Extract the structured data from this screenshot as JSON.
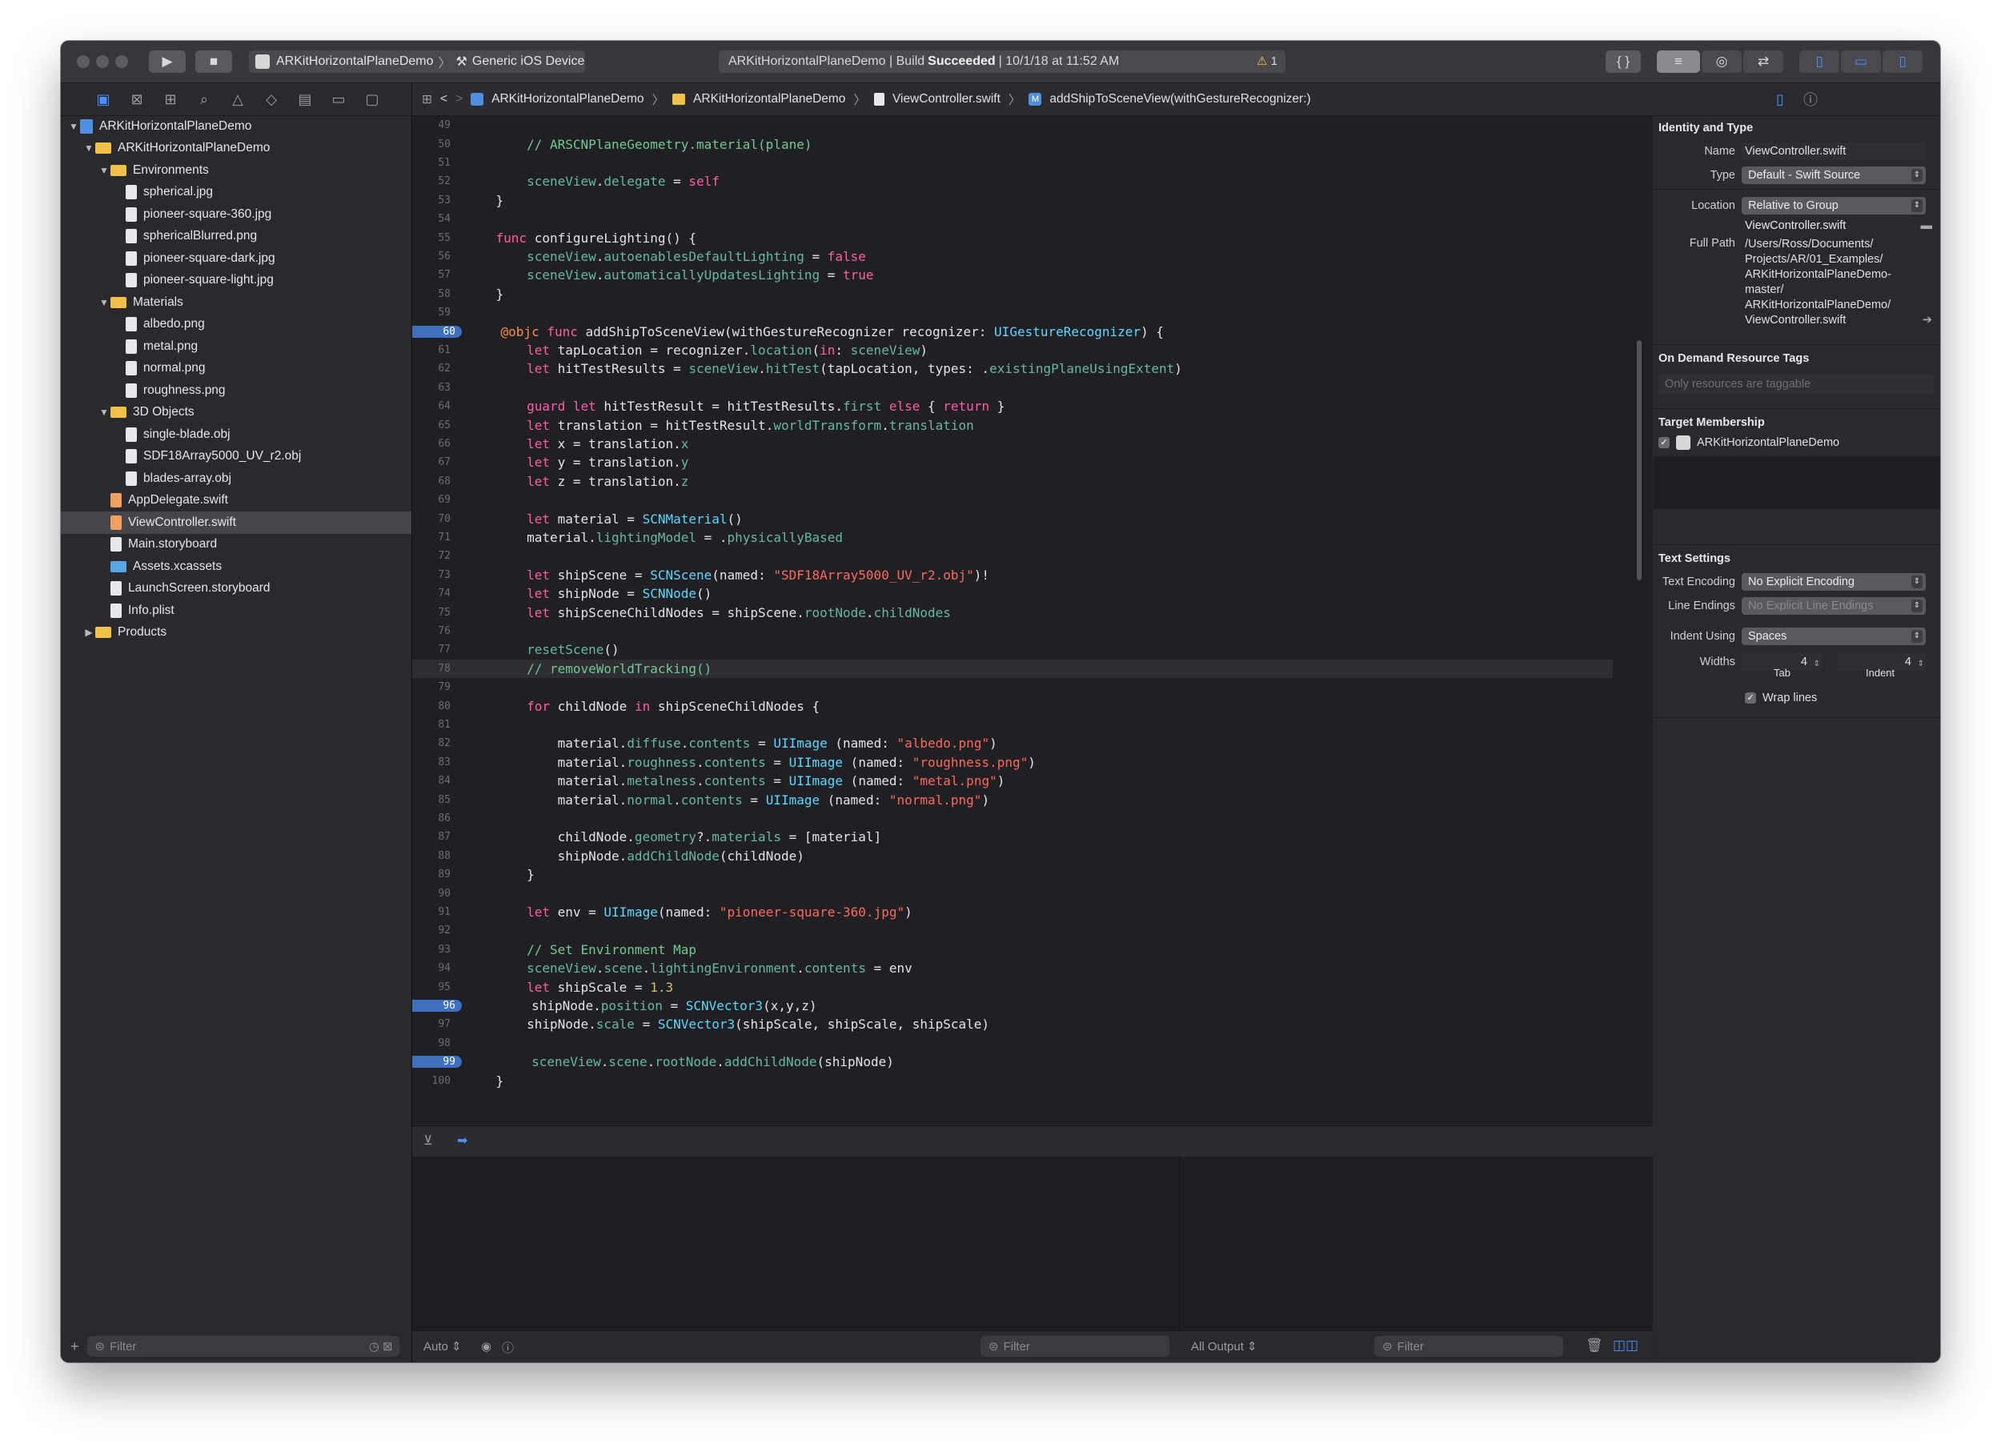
{
  "toolbar": {
    "scheme": "ARKitHorizontalPlaneDemo",
    "device": "Generic iOS Device",
    "activity_project": "ARKitHorizontalPlaneDemo | Build",
    "activity_status": "Succeeded",
    "activity_time": "| 10/1/18 at 11:52 AM",
    "warning_count": "1"
  },
  "navigator": {
    "items": [
      {
        "label": "ARKitHorizontalPlaneDemo"
      },
      {
        "label": "ARKitHorizontalPlaneDemo"
      },
      {
        "label": "Environments"
      },
      {
        "label": "spherical.jpg"
      },
      {
        "label": "pioneer-square-360.jpg"
      },
      {
        "label": "sphericalBlurred.png"
      },
      {
        "label": "pioneer-square-dark.jpg"
      },
      {
        "label": "pioneer-square-light.jpg"
      },
      {
        "label": "Materials"
      },
      {
        "label": "albedo.png"
      },
      {
        "label": "metal.png"
      },
      {
        "label": "normal.png"
      },
      {
        "label": "roughness.png"
      },
      {
        "label": "3D Objects"
      },
      {
        "label": "single-blade.obj"
      },
      {
        "label": "SDF18Array5000_UV_r2.obj"
      },
      {
        "label": "blades-array.obj"
      },
      {
        "label": "AppDelegate.swift"
      },
      {
        "label": "ViewController.swift"
      },
      {
        "label": "Main.storyboard"
      },
      {
        "label": "Assets.xcassets"
      },
      {
        "label": "LaunchScreen.storyboard"
      },
      {
        "label": "Info.plist"
      },
      {
        "label": "Products"
      }
    ],
    "filter_placeholder": "Filter"
  },
  "jumpbar": {
    "project": "ARKitHorizontalPlaneDemo",
    "group": "ARKitHorizontalPlaneDemo",
    "file": "ViewController.swift",
    "method_badge": "M",
    "method": "addShipToSceneView(withGestureRecognizer:)"
  },
  "code": {
    "line_numbers": [
      "49",
      "50",
      "51",
      "52",
      "53",
      "54",
      "55",
      "56",
      "57",
      "58",
      "59",
      "60",
      "61",
      "62",
      "63",
      "64",
      "65",
      "66",
      "67",
      "68",
      "69",
      "70",
      "71",
      "72",
      "73",
      "74",
      "75",
      "76",
      "77",
      "78",
      "79",
      "80",
      "81",
      "82",
      "83",
      "84",
      "85",
      "86",
      "87",
      "88",
      "89",
      "90",
      "91",
      "92",
      "93",
      "94",
      "95",
      "96",
      "97",
      "98",
      "99",
      "100"
    ],
    "lines": [
      "",
      "        // ARSCNPlaneGeometry.material(plane)",
      "",
      "        sceneView.delegate = self",
      "    }",
      "",
      "    func configureLighting() {",
      "        sceneView.autoenablesDefaultLighting = false",
      "        sceneView.automaticallyUpdatesLighting = true",
      "    }",
      "",
      "    @objc func addShipToSceneView(withGestureRecognizer recognizer: UIGestureRecognizer) {",
      "        let tapLocation = recognizer.location(in: sceneView)",
      "        let hitTestResults = sceneView.hitTest(tapLocation, types: .existingPlaneUsingExtent)",
      "",
      "        guard let hitTestResult = hitTestResults.first else { return }",
      "        let translation = hitTestResult.worldTransform.translation",
      "        let x = translation.x",
      "        let y = translation.y",
      "        let z = translation.z",
      "",
      "        let material = SCNMaterial()",
      "        material.lightingModel = .physicallyBased",
      "",
      "        let shipScene = SCNScene(named: \"SDF18Array5000_UV_r2.obj\")!",
      "        let shipNode = SCNNode()",
      "        let shipSceneChildNodes = shipScene.rootNode.childNodes",
      "",
      "        resetScene()",
      "        // removeWorldTracking()",
      "",
      "        for childNode in shipSceneChildNodes {",
      "",
      "            material.diffuse.contents = UIImage (named: \"albedo.png\")",
      "            material.roughness.contents = UIImage (named: \"roughness.png\")",
      "            material.metalness.contents = UIImage (named: \"metal.png\")",
      "            material.normal.contents = UIImage (named: \"normal.png\")",
      "",
      "            childNode.geometry?.materials = [material]",
      "            shipNode.addChildNode(childNode)",
      "        }",
      "",
      "        let env = UIImage(named: \"pioneer-square-360.jpg\")",
      "",
      "        // Set Environment Map",
      "        sceneView.scene.lightingEnvironment.contents = env",
      "        let shipScale = 1.3",
      "        shipNode.position = SCNVector3(x,y,z)",
      "        shipNode.scale = SCNVector3(shipScale, shipScale, shipScale)",
      "",
      "        sceneView.scene.rootNode.addChildNode(shipNode)",
      "    }"
    ],
    "breakpoints": [
      "60",
      "96",
      "99"
    ],
    "current_line": "78"
  },
  "debug": {
    "auto_label": "Auto",
    "filter_placeholder": "Filter",
    "output_label": "All Output",
    "output_filter_placeholder": "Filter"
  },
  "inspector": {
    "identity_title": "Identity and Type",
    "name_label": "Name",
    "name_value": "ViewController.swift",
    "type_label": "Type",
    "type_value": "Default - Swift Source",
    "location_label": "Location",
    "location_value": "Relative to Group",
    "location_file": "ViewController.swift",
    "fullpath_label": "Full Path",
    "fullpath_lines": [
      "/Users/Ross/Documents/",
      "Projects/AR/01_Examples/",
      "ARKitHorizontalPlaneDemo-",
      "master/",
      "ARKitHorizontalPlaneDemo/",
      "ViewController.swift"
    ],
    "odr_title": "On Demand Resource Tags",
    "odr_placeholder": "Only resources are taggable",
    "target_title": "Target Membership",
    "target_name": "ARKitHorizontalPlaneDemo",
    "text_title": "Text Settings",
    "encoding_label": "Text Encoding",
    "encoding_value": "No Explicit Encoding",
    "line_endings_label": "Line Endings",
    "line_endings_value": "No Explicit Line Endings",
    "indent_label": "Indent Using",
    "indent_value": "Spaces",
    "widths_label": "Widths",
    "tab_value": "4",
    "indent_value_num": "4",
    "tab_label": "Tab",
    "indent_sub_label": "Indent",
    "wrap_label": "Wrap lines"
  },
  "colors": {
    "accent": "#4a90ff",
    "breakpoint": "#3f6fbf",
    "keyword": "#fc5fa3",
    "string": "#fc6a5d",
    "type": "#5dd8ff"
  }
}
